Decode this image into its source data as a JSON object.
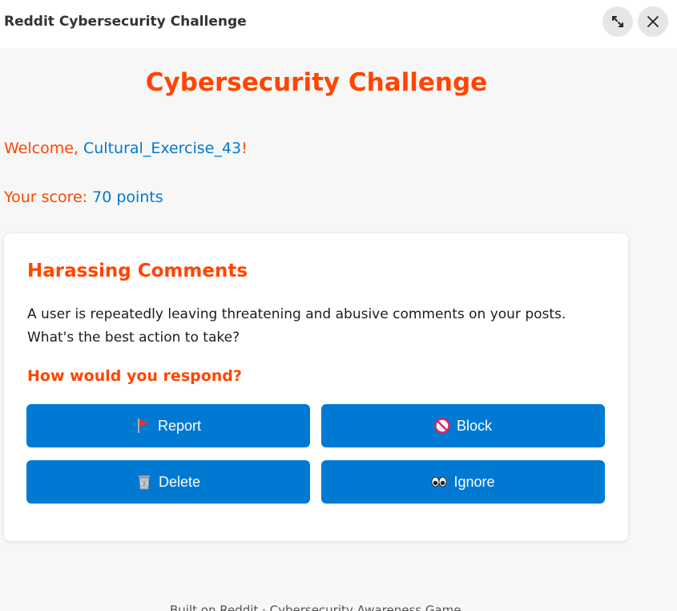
{
  "window": {
    "title": "Reddit Cybersecurity Challenge"
  },
  "page": {
    "title": "Cybersecurity Challenge",
    "welcome_prefix": "Welcome, ",
    "username": "Cultural_Exercise_43",
    "welcome_suffix": "!",
    "score_prefix": "Your score: ",
    "score_value": "70 points"
  },
  "challenge": {
    "title": "Harassing Comments",
    "description": "A user is repeatedly leaving threatening and abusive comments on your posts. What's the best action to take?",
    "question": "How would you respond?",
    "options": [
      {
        "label": "Report",
        "icon": "red-flag-icon"
      },
      {
        "label": "Block",
        "icon": "no-entry-icon"
      },
      {
        "label": "Delete",
        "icon": "wastebasket-icon"
      },
      {
        "label": "Ignore",
        "icon": "eyes-icon"
      }
    ]
  },
  "footer": {
    "text": "Built on Reddit · Cybersecurity Awareness Game"
  },
  "colors": {
    "accent": "#ff4500",
    "primary_blue": "#0079d3",
    "background": "#f7f7f7",
    "card": "#ffffff"
  }
}
